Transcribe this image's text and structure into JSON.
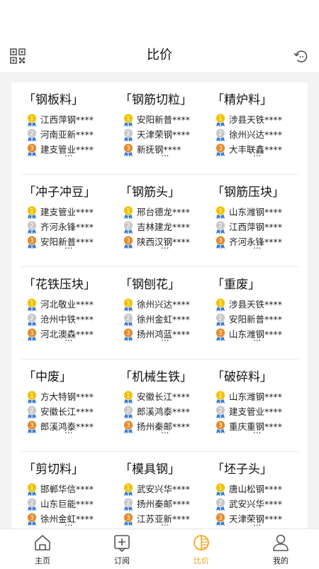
{
  "header": {
    "title": "比价"
  },
  "grid": [
    [
      {
        "category": "「钢板料」",
        "ranks": [
          "江西萍钢****",
          "河南亚新****",
          "建支管业****"
        ],
        "more": "..."
      },
      {
        "category": "「钢筋切粒」",
        "ranks": [
          "安阳新普****",
          "天津荣钢****",
          "新抚钢****"
        ],
        "more": "..."
      },
      {
        "category": "「精炉料」",
        "ranks": [
          "涉县天铁****",
          "徐州兴达****",
          "大丰联鑫****"
        ],
        "more": "..."
      }
    ],
    [
      {
        "category": "「冲子冲豆」",
        "ranks": [
          "建支管业****",
          "齐河永锋****",
          "安阳新普****"
        ],
        "more": "..."
      },
      {
        "category": "「钢筋头」",
        "ranks": [
          "邢台德龙****",
          "吉林建龙****",
          "陕西汉钢****"
        ],
        "more": "..."
      },
      {
        "category": "「钢筋压块」",
        "ranks": [
          "山东潍钢****",
          "江西萍钢****",
          "齐河永锋****"
        ],
        "more": "..."
      }
    ],
    [
      {
        "category": "「花铁压块」",
        "ranks": [
          "河北敬业****",
          "沧州中铁****",
          "河北澳森****"
        ],
        "more": "..."
      },
      {
        "category": "「钢刨花」",
        "ranks": [
          "徐州兴达****",
          "徐州金虹****",
          "扬州鸿蓝****"
        ],
        "more": "..."
      },
      {
        "category": "「重废」",
        "ranks": [
          "涉县天铁****",
          "安阳新普****",
          "山东潍钢****"
        ],
        "more": "..."
      }
    ],
    [
      {
        "category": "「中废」",
        "ranks": [
          "方大特钢****",
          "安徽长江****",
          "郎溪鸿泰****"
        ],
        "more": "..."
      },
      {
        "category": "「机械生铁」",
        "ranks": [
          "安徽长江****",
          "郎溪鸿泰****",
          "扬州秦邮****"
        ],
        "more": "..."
      },
      {
        "category": "「破碎料」",
        "ranks": [
          "山东潍钢****",
          "建支管业****",
          "重庆重钢****"
        ],
        "more": "..."
      }
    ],
    [
      {
        "category": "「剪切料」",
        "ranks": [
          "邯郸华信****",
          "山东巨能****",
          "徐州金虹****"
        ],
        "more": "..."
      },
      {
        "category": "「模具钢」",
        "ranks": [
          "武安兴华****",
          "扬州秦邮****",
          "江苏亚新****"
        ],
        "more": "..."
      },
      {
        "category": "「坯子头」",
        "ranks": [
          "唐山松钢****",
          "武安兴华****",
          "天津荣钢****"
        ],
        "more": "..."
      }
    ]
  ],
  "tabs": [
    {
      "label": "主页",
      "icon": "home-icon"
    },
    {
      "label": "订阅",
      "icon": "subscribe-icon"
    },
    {
      "label": "比价",
      "icon": "compare-icon",
      "active": true
    },
    {
      "label": "我的",
      "icon": "profile-icon"
    }
  ],
  "colors": {
    "accent": "#f5a623",
    "gold": "#f2c200",
    "silver": "#c8c8c8",
    "bronze": "#e38a2a",
    "ribbon": "#3a7bd5"
  }
}
